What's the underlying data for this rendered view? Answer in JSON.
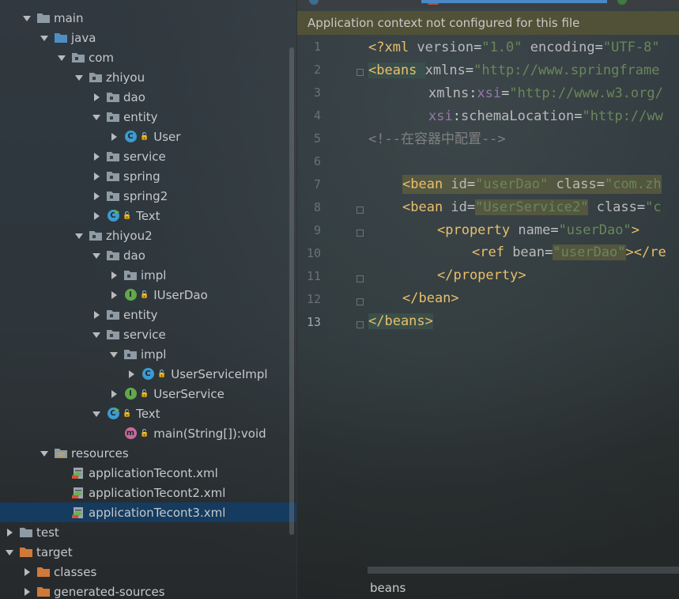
{
  "project_tree": {
    "items": [
      {
        "label": "main",
        "arrow": "down",
        "icon": "folder-icon"
      },
      {
        "label": "java",
        "arrow": "down",
        "icon": "source-folder-icon"
      },
      {
        "label": "com",
        "arrow": "down",
        "icon": "package-icon"
      },
      {
        "label": "zhiyou",
        "arrow": "down",
        "icon": "package-icon"
      },
      {
        "label": "dao",
        "arrow": "right",
        "icon": "package-icon"
      },
      {
        "label": "entity",
        "arrow": "down",
        "icon": "package-icon"
      },
      {
        "label": "User",
        "arrow": "right",
        "icon": "class-icon",
        "badge": "C"
      },
      {
        "label": "service",
        "arrow": "right",
        "icon": "package-icon"
      },
      {
        "label": "spring",
        "arrow": "right",
        "icon": "package-icon"
      },
      {
        "label": "spring2",
        "arrow": "right",
        "icon": "package-icon"
      },
      {
        "label": "Text",
        "arrow": "right",
        "icon": "runnable-class-icon",
        "badge": "C"
      },
      {
        "label": "zhiyou2",
        "arrow": "down",
        "icon": "package-icon"
      },
      {
        "label": "dao",
        "arrow": "down",
        "icon": "package-icon"
      },
      {
        "label": "impl",
        "arrow": "right",
        "icon": "package-icon"
      },
      {
        "label": "IUserDao",
        "arrow": "right",
        "icon": "interface-icon",
        "badge": "I"
      },
      {
        "label": "entity",
        "arrow": "right",
        "icon": "package-icon"
      },
      {
        "label": "service",
        "arrow": "down",
        "icon": "package-icon"
      },
      {
        "label": "impl",
        "arrow": "down",
        "icon": "package-icon"
      },
      {
        "label": "UserServiceImpl",
        "arrow": "right",
        "icon": "class-icon",
        "badge": "C"
      },
      {
        "label": "UserService",
        "arrow": "right",
        "icon": "interface-icon",
        "badge": "I"
      },
      {
        "label": "Text",
        "arrow": "down",
        "icon": "runnable-class-icon",
        "badge": "C"
      },
      {
        "label": "main(String[]):void",
        "arrow": "none",
        "icon": "method-icon",
        "badge": "m"
      },
      {
        "label": "resources",
        "arrow": "down",
        "icon": "resources-folder-icon"
      },
      {
        "label": "applicationTecont.xml",
        "arrow": "none",
        "icon": "spring-xml-icon"
      },
      {
        "label": "applicationTecont2.xml",
        "arrow": "none",
        "icon": "spring-xml-icon"
      },
      {
        "label": "applicationTecont3.xml",
        "arrow": "none",
        "icon": "spring-xml-icon"
      },
      {
        "label": "test",
        "arrow": "right",
        "icon": "folder-icon"
      },
      {
        "label": "target",
        "arrow": "down",
        "icon": "excluded-folder-icon"
      },
      {
        "label": "classes",
        "arrow": "right",
        "icon": "excluded-folder-icon"
      },
      {
        "label": "generated-sources",
        "arrow": "right",
        "icon": "excluded-folder-icon"
      }
    ],
    "selected_label": "applicationTecont3.xml"
  },
  "editor": {
    "banner": "Application context not configured for this file",
    "current_line": "13",
    "line_numbers": [
      "1",
      "2",
      "3",
      "4",
      "5",
      "6",
      "7",
      "8",
      "9",
      "10",
      "11",
      "12",
      "13"
    ],
    "breadcrumb": "beans",
    "colors": {
      "tag": "#e8bf6a",
      "attribute": "#bababa",
      "namespace": "#9876aa",
      "value": "#6a8759",
      "comment": "#808080",
      "selection": "#133d64",
      "banner": "#535335"
    },
    "code": {
      "l1": {
        "open": "<?xml ",
        "a1": "version",
        "eq1": "=",
        "v1": "\"1.0\"",
        "sp": " ",
        "a2": "encoding",
        "eq2": "=",
        "v2": "\"UTF-8\""
      },
      "l2": {
        "open": "<beans ",
        "a1": "xmlns",
        "eq1": "=",
        "v1": "\"http://www.springframe"
      },
      "l3": {
        "a1": "xmlns",
        "colon": ":",
        "ns": "xsi",
        "eq1": "=",
        "v1": "\"http://www.w3.org/"
      },
      "l4": {
        "ns": "xsi",
        "colon": ":",
        "a1": "schemaLocation",
        "eq1": "=",
        "v1": "\"http://ww"
      },
      "l5": {
        "comment": "<!--在容器中配置-->"
      },
      "l7": {
        "open": "<bean ",
        "a1": "id",
        "eq1": "=",
        "v1": "\"userDao\"",
        "sp": " ",
        "a2": "class",
        "eq2": "=",
        "v2": "\"com.zh"
      },
      "l8": {
        "open": "<bean ",
        "a1": "id",
        "eq1": "=",
        "v1": "\"UserService2\"",
        "sp": " ",
        "a2": "class",
        "eq2": "=",
        "v2": "\"c"
      },
      "l9": {
        "open": "<property ",
        "a1": "name",
        "eq1": "=",
        "v1": "\"userDao\"",
        "close": ">"
      },
      "l10": {
        "open": "<ref ",
        "a1": "bean",
        "eq1": "=",
        "v1": "\"userDao\"",
        "close": "></re"
      },
      "l11": {
        "tag": "</property>"
      },
      "l12": {
        "tag": "</bean>"
      },
      "l13": {
        "tag": "</beans>"
      }
    }
  }
}
